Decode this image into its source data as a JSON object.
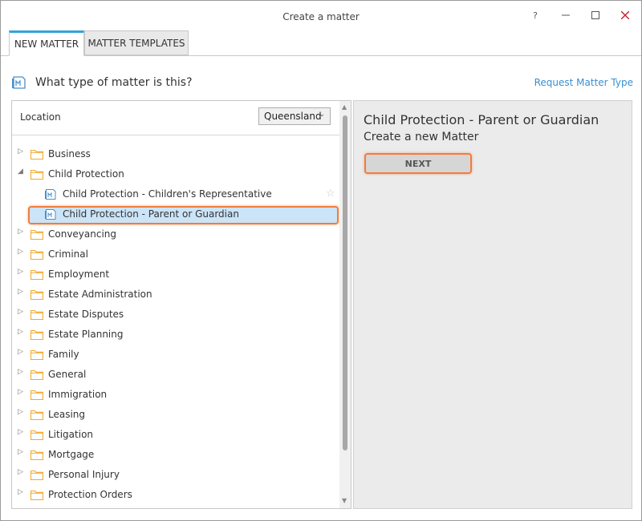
{
  "window": {
    "title": "Create a matter",
    "help_label": "?",
    "minimize_label": "—",
    "maximize_label": "☐",
    "close_label": "✕"
  },
  "tabs": [
    {
      "label": "NEW MATTER",
      "active": true
    },
    {
      "label": "MATTER TEMPLATES",
      "active": false
    }
  ],
  "header": {
    "title": "What type of matter is this?",
    "request_link": "Request Matter Type"
  },
  "location": {
    "label": "Location",
    "selected": "Queensland"
  },
  "tree": {
    "items": [
      {
        "label": "Business",
        "expanded": false
      },
      {
        "label": "Child Protection",
        "expanded": true
      },
      {
        "label": "Child Protection - Children's Representative",
        "child": true
      },
      {
        "label": "Child Protection - Parent or Guardian",
        "child": true,
        "selected": true
      },
      {
        "label": "Conveyancing",
        "expanded": false
      },
      {
        "label": "Criminal",
        "expanded": false
      },
      {
        "label": "Employment",
        "expanded": false
      },
      {
        "label": "Estate Administration",
        "expanded": false
      },
      {
        "label": "Estate Disputes",
        "expanded": false
      },
      {
        "label": "Estate Planning",
        "expanded": false
      },
      {
        "label": "Family",
        "expanded": false
      },
      {
        "label": "General",
        "expanded": false
      },
      {
        "label": "Immigration",
        "expanded": false
      },
      {
        "label": "Leasing",
        "expanded": false
      },
      {
        "label": "Litigation",
        "expanded": false
      },
      {
        "label": "Mortgage",
        "expanded": false
      },
      {
        "label": "Personal Injury",
        "expanded": false
      },
      {
        "label": "Protection Orders",
        "expanded": false
      }
    ]
  },
  "detail": {
    "title": "Child Protection - Parent or Guardian",
    "subtitle": "Create a new Matter",
    "next_label": "NEXT"
  },
  "colors": {
    "accent": "#35a3d9",
    "highlight": "#f07d3d",
    "selection": "#cce4f7",
    "folder": "#f0a830",
    "link": "#3a8fd1"
  }
}
